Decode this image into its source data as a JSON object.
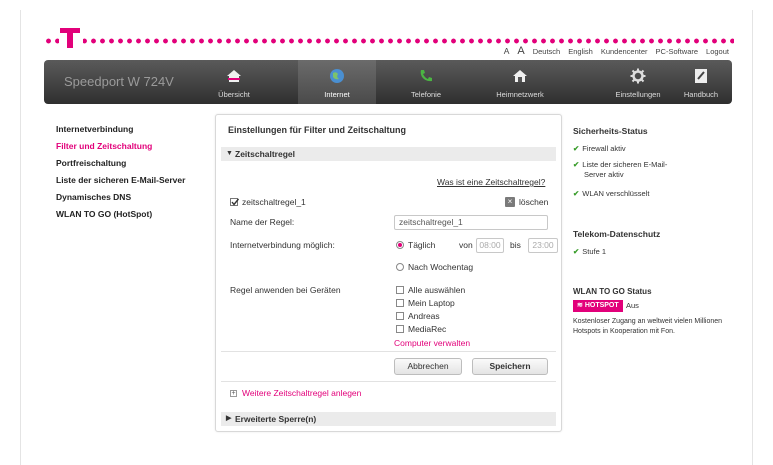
{
  "brand": {
    "logo_letter": "T",
    "accent": "#e2007a"
  },
  "toplinks": [
    "A",
    "A",
    "Deutsch",
    "English",
    "Kundencenter",
    "PC-Software",
    "Logout"
  ],
  "navbar": {
    "model": "Speedport W 724V",
    "items": [
      {
        "label": "Übersicht",
        "icon": "home-icon"
      },
      {
        "label": "Internet",
        "icon": "globe-icon"
      },
      {
        "label": "Telefonie",
        "icon": "phone-icon"
      },
      {
        "label": "Heimnetzwerk",
        "icon": "house-network-icon"
      },
      {
        "label": "Einstellungen",
        "icon": "gear-icon"
      },
      {
        "label": "Handbuch",
        "icon": "book-icon"
      }
    ],
    "active": "Internet"
  },
  "sidebar": {
    "items": [
      {
        "label": "Internetverbindung"
      },
      {
        "label": "Filter und Zeitschaltung"
      },
      {
        "label": "Portfreischaltung"
      },
      {
        "label": "Liste der sicheren E-Mail-Server"
      },
      {
        "label": "Dynamisches DNS"
      },
      {
        "label": "WLAN TO GO (HotSpot)"
      }
    ],
    "active": "Filter und Zeitschaltung"
  },
  "panel": {
    "title": "Einstellungen für Filter und Zeitschaltung",
    "section_timer": "Zeitschaltregel",
    "help_link": "Was ist eine Zeitschaltregel?",
    "rule_checkbox_label": "zeitschaltregel_1",
    "delete_label": "löschen",
    "rule_name_label": "Name der Regel:",
    "rule_name_value": "zeitschaltregel_1",
    "connection_label": "Internetverbindung möglich:",
    "daily_label": "Täglich",
    "from_label": "von",
    "from_value": "08:00",
    "to_label": "bis",
    "to_value": "23:00",
    "weekday_label": "Nach Wochentag",
    "devices_label": "Regel anwenden bei Geräten",
    "devices": [
      {
        "label": "Alle auswählen"
      },
      {
        "label": "Mein Laptop"
      },
      {
        "label": "Andreas"
      },
      {
        "label": "MediaRec"
      }
    ],
    "manage_link": "Computer verwalten",
    "cancel_button": "Abbrechen",
    "save_button": "Speichern",
    "add_rule_link": "Weitere Zeitschaltregel anlegen",
    "section_extended": "Erweiterte Sperre(n)"
  },
  "right": {
    "security_title": "Sicherheits-Status",
    "security_items": [
      {
        "text": "Firewall aktiv"
      },
      {
        "text": "Liste der sicheren E-Mail-Server aktiv"
      },
      {
        "text": "WLAN verschlüsselt"
      }
    ],
    "privacy_title": "Telekom-Datenschutz",
    "privacy_item": "Stufe 1",
    "wlan_title": "WLAN TO GO Status",
    "hotspot_badge": "HOTSPOT",
    "hotspot_status": "Aus",
    "hotspot_desc": "Kostenloser Zugang an weltweit vielen Millionen Hotspots in Kooperation mit Fon."
  }
}
